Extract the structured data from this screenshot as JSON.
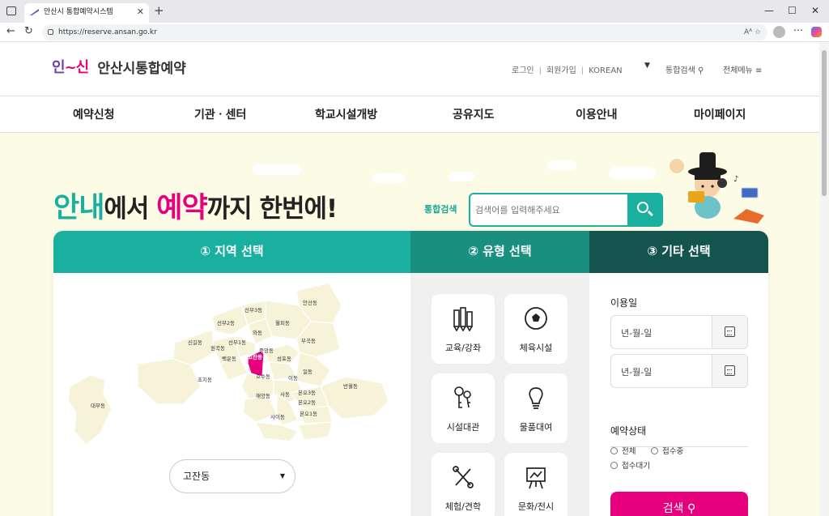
{
  "browser": {
    "tab_title": "안산시 통합예약시스템",
    "tab_close": "✕",
    "new_tab": "+",
    "url": "https://reserve.ansan.go.kr",
    "url_icons": "Aᴬ  ☆",
    "controls": {
      "minimize": "—",
      "maximize": "☐",
      "close": "✕"
    }
  },
  "header": {
    "logo_mark_a": "인",
    "logo_mark_b": "~신",
    "logo_text": "안산시통합예약",
    "login": "로그인",
    "join": "회원가입",
    "language": "KOREAN",
    "integrated_search": "통합검색",
    "all_menu": "전체메뉴"
  },
  "gnb": [
    "예약신청",
    "기관ㆍ센터",
    "학교시설개방",
    "공유지도",
    "이용안내",
    "마이페이지"
  ],
  "hero": {
    "slogan": {
      "p1": "안내",
      "p2": "에서 ",
      "p3": "예약",
      "p4": "까지 ",
      "p5": "한번에!"
    },
    "search_label": "통합검색",
    "search_placeholder": "검색어를 입력해주세요"
  },
  "steps": {
    "s1": "① 지역 선택",
    "s2": "② 유형 선택",
    "s3": "③ 기타 선택"
  },
  "map": {
    "districts": [
      "선부3동",
      "안산동",
      "선부2동",
      "월피동",
      "와동",
      "신길동",
      "선부1동",
      "원곡동",
      "부곡동",
      "고잔동",
      "중앙동",
      "백운동",
      "성포동",
      "초지동",
      "호수동",
      "일동",
      "이동",
      "반월동",
      "대부동",
      "해양동",
      "사동",
      "본오3동",
      "본오2동",
      "사이동",
      "본오1동"
    ],
    "selected": "고잔동",
    "colors": {
      "fill": "#f6f3d8",
      "stroke": "#ffffff",
      "selected": "#e6007e"
    }
  },
  "types": [
    "교육/강좌",
    "체육시설",
    "시설대관",
    "물품대여",
    "체험/견학",
    "문화/전시"
  ],
  "etc": {
    "use_date_label": "이용일",
    "date_placeholder": "년-월-일",
    "status_label": "예약상태",
    "statuses": [
      "전체",
      "접수중",
      "접수대기"
    ],
    "search_button": "검색"
  },
  "colors": {
    "teal": "#1ab0a0",
    "teal_dark": "#14544f",
    "pink": "#e6007e",
    "hero_bg": "#fcfbe6"
  }
}
